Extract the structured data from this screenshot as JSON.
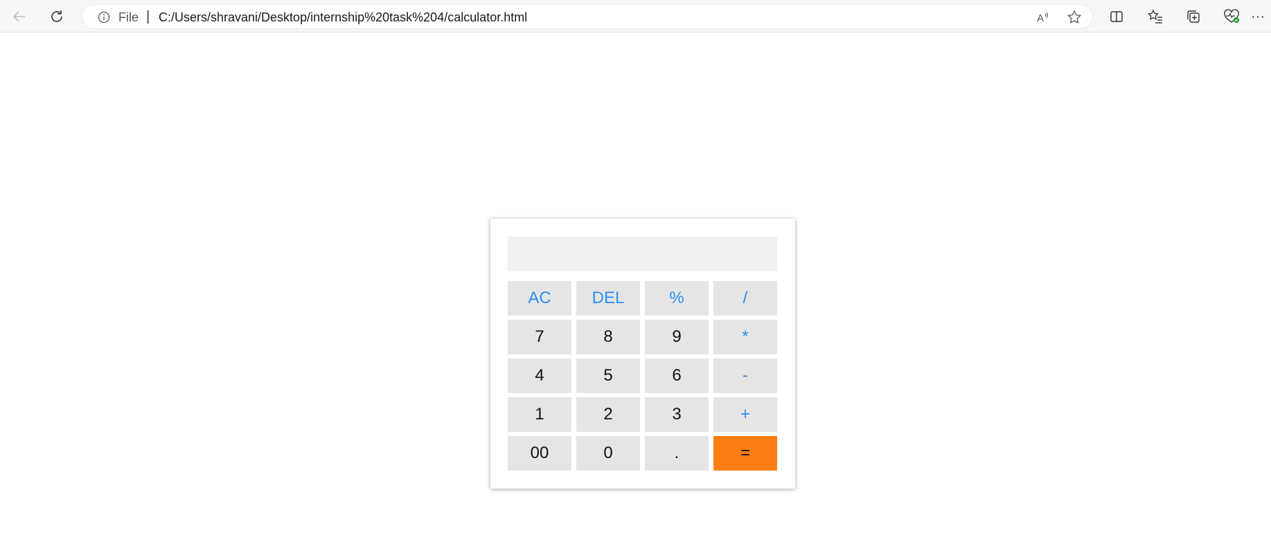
{
  "browser": {
    "address_info": "File",
    "separator": "|",
    "url": "C:/Users/shravani/Desktop/internship%20task%204/calculator.html",
    "more_label": "···"
  },
  "calculator": {
    "display_value": "",
    "keys": [
      {
        "label": "AC",
        "kind": "op"
      },
      {
        "label": "DEL",
        "kind": "op"
      },
      {
        "label": "%",
        "kind": "op"
      },
      {
        "label": "/",
        "kind": "op"
      },
      {
        "label": "7",
        "kind": "num"
      },
      {
        "label": "8",
        "kind": "num"
      },
      {
        "label": "9",
        "kind": "num"
      },
      {
        "label": "*",
        "kind": "op"
      },
      {
        "label": "4",
        "kind": "num"
      },
      {
        "label": "5",
        "kind": "num"
      },
      {
        "label": "6",
        "kind": "num"
      },
      {
        "label": "-",
        "kind": "op"
      },
      {
        "label": "1",
        "kind": "num"
      },
      {
        "label": "2",
        "kind": "num"
      },
      {
        "label": "3",
        "kind": "num"
      },
      {
        "label": "+",
        "kind": "op"
      },
      {
        "label": "00",
        "kind": "num"
      },
      {
        "label": "0",
        "kind": "num"
      },
      {
        "label": ".",
        "kind": "num"
      },
      {
        "label": "=",
        "kind": "eq"
      }
    ],
    "colors": {
      "operator": "#2b8ef0",
      "equals": "#fb7d14",
      "key_bg": "#e5e5e5",
      "display_bg": "#f1f1f1"
    }
  }
}
